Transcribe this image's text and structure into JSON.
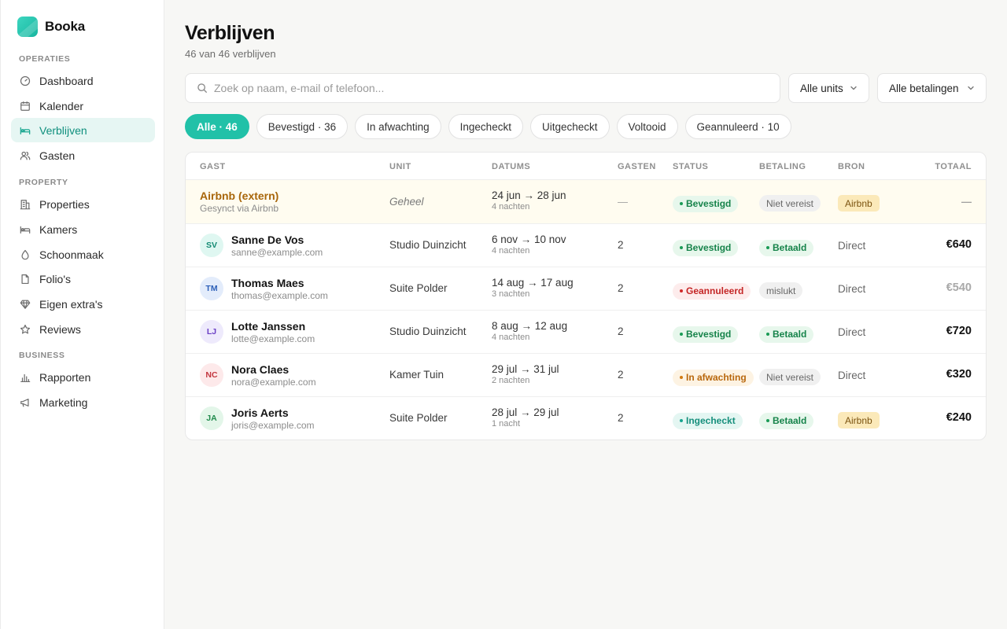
{
  "brand": {
    "name": "Booka"
  },
  "sidebar": {
    "sections": [
      {
        "label": "OPERATIES"
      },
      {
        "label": "PROPERTY"
      },
      {
        "label": "BUSINESS"
      }
    ],
    "items": [
      {
        "label": "Dashboard",
        "icon": "gauge-icon"
      },
      {
        "label": "Kalender",
        "icon": "calendar-icon"
      },
      {
        "label": "Verblijven",
        "icon": "bed-icon",
        "active": true
      },
      {
        "label": "Gasten",
        "icon": "users-icon"
      },
      {
        "label": "Properties",
        "icon": "building-icon"
      },
      {
        "label": "Kamers",
        "icon": "bed-icon"
      },
      {
        "label": "Schoonmaak",
        "icon": "droplet-icon"
      },
      {
        "label": "Folio's",
        "icon": "document-icon"
      },
      {
        "label": "Eigen extra's",
        "icon": "gem-icon"
      },
      {
        "label": "Reviews",
        "icon": "star-icon"
      },
      {
        "label": "Rapporten",
        "icon": "bar-chart-icon"
      },
      {
        "label": "Marketing",
        "icon": "megaphone-icon"
      }
    ]
  },
  "header": {
    "title": "Verblijven",
    "subtitle": "46 van 46 verblijven"
  },
  "search": {
    "placeholder": "Zoek op naam, e-mail of telefoon..."
  },
  "filters": {
    "units": "Alle units",
    "payments": "Alle betalingen"
  },
  "chips": [
    {
      "label": "Alle · 46",
      "active": true
    },
    {
      "label": "Bevestigd · 36"
    },
    {
      "label": "In afwachting"
    },
    {
      "label": "Ingecheckt"
    },
    {
      "label": "Uitgecheckt"
    },
    {
      "label": "Voltooid"
    },
    {
      "label": "Geannuleerd · 10"
    }
  ],
  "table": {
    "columns": [
      "GAST",
      "UNIT",
      "DATUMS",
      "GASTEN",
      "STATUS",
      "BETALING",
      "BRON",
      "TOTAAL"
    ],
    "external_row": {
      "name": "Airbnb (extern)",
      "sub": "Gesynct via Airbnb",
      "unit": "Geheel",
      "dates": "24 jun → 28 jun",
      "nights": "4 nachten",
      "guests": "—",
      "status": "Bevestigd",
      "payment": "Niet vereist",
      "source": "Airbnb",
      "total": "—"
    },
    "rows": [
      {
        "initials": "SV",
        "avatar_bg": "#dff7f1",
        "avatar_fg": "#138a73",
        "name": "Sanne De Vos",
        "email": "sanne@example.com",
        "unit": "Studio Duinzicht",
        "dates": "6 nov → 10 nov",
        "nights": "4 nachten",
        "guests": "2",
        "status": "Bevestigd",
        "status_kind": "green",
        "payment": "Betaald",
        "payment_kind": "green",
        "source": "Direct",
        "total": "€640"
      },
      {
        "initials": "TM",
        "avatar_bg": "#e3ecfb",
        "avatar_fg": "#2d5fb8",
        "name": "Thomas Maes",
        "email": "thomas@example.com",
        "unit": "Suite Polder",
        "dates": "14 aug → 17 aug",
        "nights": "3 nachten",
        "guests": "2",
        "status": "Geannuleerd",
        "status_kind": "red",
        "payment": "mislukt",
        "payment_kind": "gray",
        "source": "Direct",
        "total": "€540",
        "total_muted": true
      },
      {
        "initials": "LJ",
        "avatar_bg": "#eeeafc",
        "avatar_fg": "#6a3fc4",
        "name": "Lotte Janssen",
        "email": "lotte@example.com",
        "unit": "Studio Duinzicht",
        "dates": "8 aug → 12 aug",
        "nights": "4 nachten",
        "guests": "2",
        "status": "Bevestigd",
        "status_kind": "green",
        "payment": "Betaald",
        "payment_kind": "green",
        "source": "Direct",
        "total": "€720"
      },
      {
        "initials": "NC",
        "avatar_bg": "#fde9ea",
        "avatar_fg": "#c3363f",
        "name": "Nora Claes",
        "email": "nora@example.com",
        "unit": "Kamer Tuin",
        "dates": "29 jul → 31 jul",
        "nights": "2 nachten",
        "guests": "2",
        "status": "In afwachting",
        "status_kind": "orange",
        "payment": "Niet vereist",
        "payment_kind": "gray",
        "source": "Direct",
        "total": "€320"
      },
      {
        "initials": "JA",
        "avatar_bg": "#e3f6e9",
        "avatar_fg": "#208a4c",
        "name": "Joris Aerts",
        "email": "joris@example.com",
        "unit": "Suite Polder",
        "dates": "28 jul → 29 jul",
        "nights": "1 nacht",
        "guests": "2",
        "status": "Ingecheckt",
        "status_kind": "teal",
        "payment": "Betaald",
        "payment_kind": "green",
        "source": "Airbnb",
        "source_kind": "airbnb",
        "total": "€240"
      }
    ]
  }
}
